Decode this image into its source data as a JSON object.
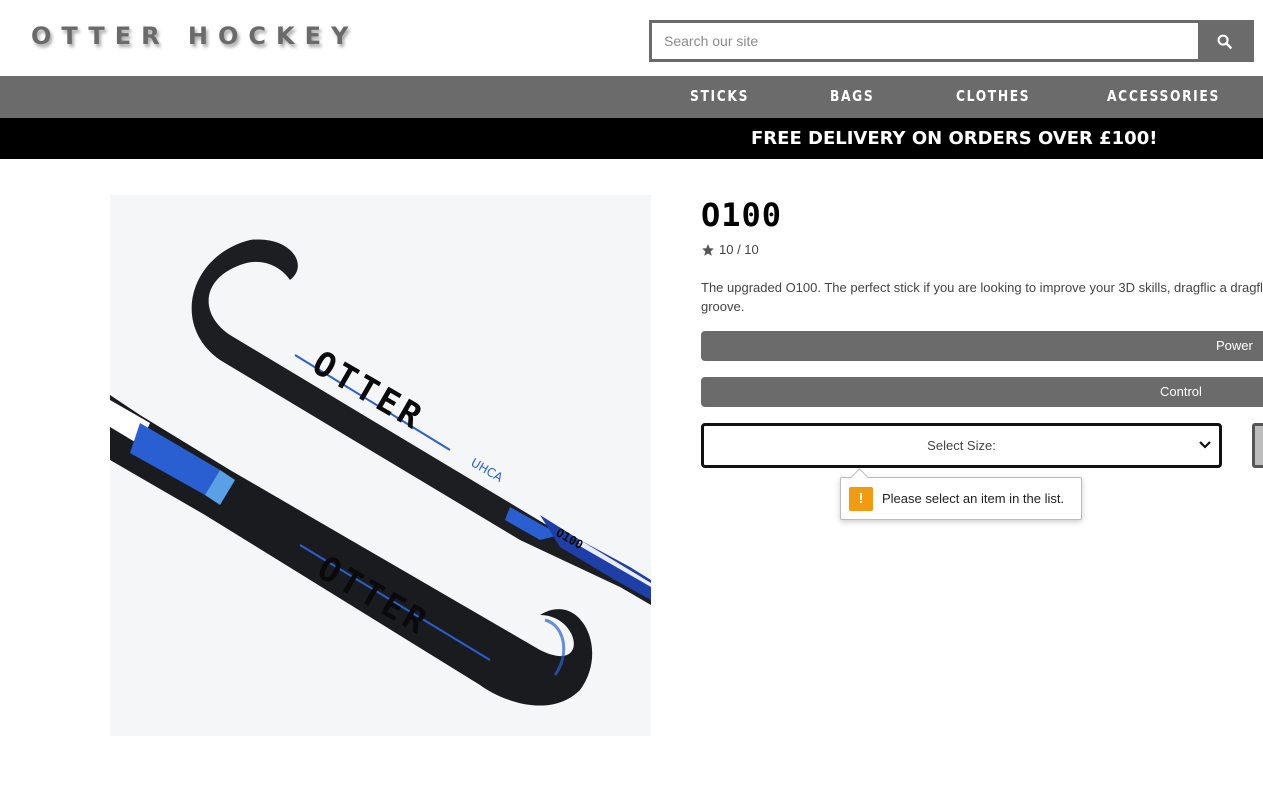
{
  "header": {
    "logo_text": "OTTER HOCKEY",
    "search_placeholder": "Search our site",
    "search_icon": "search-icon"
  },
  "nav": {
    "items": [
      "STICKS",
      "BAGS",
      "CLOTHES",
      "ACCESSORIES"
    ]
  },
  "banner": {
    "text": "FREE DELIVERY ON ORDERS OVER £100!"
  },
  "product": {
    "name": "O100",
    "rating_text": "10 / 10",
    "rating_icon": "star-icon",
    "description": "The upgraded O100. The perfect stick if you are looking to improve your 3D skills, dragflic a dragflicking groove.",
    "image_alt": "Otter O100 hockey stick",
    "stick_brand_text": "OTTER",
    "stick_model_text": "O100",
    "stick_series_text": "UHCA",
    "attributes": [
      {
        "label": "Power"
      },
      {
        "label": "Control"
      }
    ],
    "size_select": {
      "selected": "Select Size:",
      "validation_message": "Please select an item in the list."
    }
  },
  "colors": {
    "nav_bg": "#6b6b6b",
    "banner_bg": "#000000",
    "warning": "#f29a10",
    "stick_accent": "#2a5fd1"
  }
}
